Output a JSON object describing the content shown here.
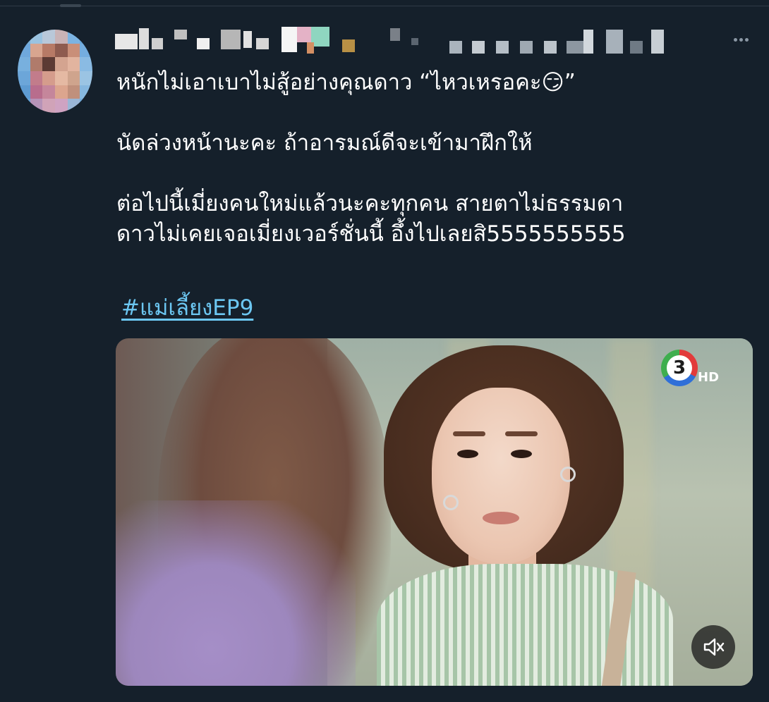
{
  "tweet": {
    "text": "หนักไม่เอาเบาไม่สู้อย่างคุณดาว “ไหวเหรอคะ😏”\n\nนัดล่วงหน้านะคะ ถ้าอารมณ์ดีจะเข้ามาฝึกให้\n\nต่อไปนี้เมี่ยงคนใหม่แล้วนะคะทุกคน สายตาไม่ธรรมดา\nดาวไม่เคยเจอเมี่ยงเวอร์ชั่นนี้ อึ้งไปเลยสิ5555555555",
    "hashtag": "#แม่เลี้ยงEP9"
  },
  "media": {
    "channel_logo": "3",
    "channel_quality": "HD",
    "mute_icon": "speaker-muted-icon"
  },
  "colors": {
    "background": "#15202b",
    "hashtag": "#6cc7f2",
    "text": "#ffffff"
  }
}
